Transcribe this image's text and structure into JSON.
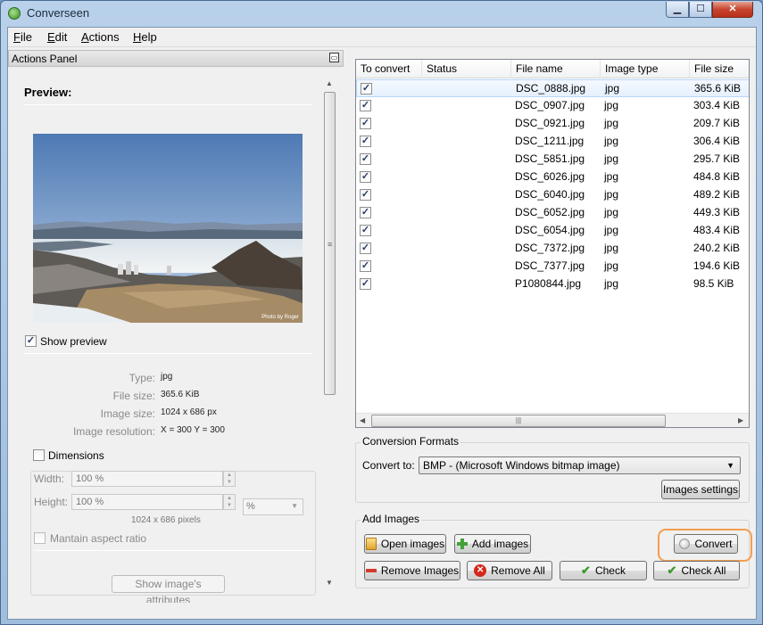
{
  "window": {
    "title": "Converseen"
  },
  "menu": [
    "File",
    "Edit",
    "Actions",
    "Help"
  ],
  "actions_panel": {
    "title": "Actions Panel",
    "preview_title": "Preview:",
    "photo_credit": "Photo by Roger",
    "show_preview": {
      "label": "Show preview",
      "checked": true
    },
    "info": {
      "type_label": "Type:",
      "type_value": "jpg",
      "size_label": "File size:",
      "size_value": "365.6 KiB",
      "dims_label": "Image size:",
      "dims_value": "1024 x 686 px",
      "res_label": "Image resolution:",
      "res_value": "X = 300 Y = 300"
    },
    "dimensions": {
      "label": "Dimensions",
      "checked": false,
      "width_label": "Width:",
      "width_value": "100 %",
      "height_label": "Height:",
      "height_value": "100 %",
      "unit": "%",
      "pixels": "1024 x 686 pixels",
      "aspect_label": "Mantain aspect ratio",
      "attributes_button": "Show image's attributes"
    }
  },
  "table": {
    "columns": [
      "To convert",
      "Status",
      "File name",
      "Image type",
      "File size"
    ],
    "rows": [
      {
        "checked": true,
        "status": "",
        "name": "DSC_0888.jpg",
        "type": "jpg",
        "size": "365.6 KiB"
      },
      {
        "checked": true,
        "status": "",
        "name": "DSC_0907.jpg",
        "type": "jpg",
        "size": "303.4 KiB"
      },
      {
        "checked": true,
        "status": "",
        "name": "DSC_0921.jpg",
        "type": "jpg",
        "size": "209.7 KiB"
      },
      {
        "checked": true,
        "status": "",
        "name": "DSC_1211.jpg",
        "type": "jpg",
        "size": "306.4 KiB"
      },
      {
        "checked": true,
        "status": "",
        "name": "DSC_5851.jpg",
        "type": "jpg",
        "size": "295.7 KiB"
      },
      {
        "checked": true,
        "status": "",
        "name": "DSC_6026.jpg",
        "type": "jpg",
        "size": "484.8 KiB"
      },
      {
        "checked": true,
        "status": "",
        "name": "DSC_6040.jpg",
        "type": "jpg",
        "size": "489.2 KiB"
      },
      {
        "checked": true,
        "status": "",
        "name": "DSC_6052.jpg",
        "type": "jpg",
        "size": "449.3 KiB"
      },
      {
        "checked": true,
        "status": "",
        "name": "DSC_6054.jpg",
        "type": "jpg",
        "size": "483.4 KiB"
      },
      {
        "checked": true,
        "status": "",
        "name": "DSC_7372.jpg",
        "type": "jpg",
        "size": "240.2 KiB"
      },
      {
        "checked": true,
        "status": "",
        "name": "DSC_7377.jpg",
        "type": "jpg",
        "size": "194.6 KiB"
      },
      {
        "checked": true,
        "status": "",
        "name": "P1080844.jpg",
        "type": "jpg",
        "size": "98.5 KiB"
      }
    ]
  },
  "conversion": {
    "title": "Conversion Formats",
    "convert_to_label": "Convert to:",
    "format": "BMP - (Microsoft Windows bitmap image)",
    "settings_button": "Images settings"
  },
  "add_images": {
    "title": "Add Images",
    "open": "Open images",
    "add": "Add images",
    "convert": "Convert",
    "remove": "Remove Images",
    "remove_all": "Remove All",
    "check": "Check",
    "check_all": "Check All"
  },
  "colors": {
    "highlight": "#f29d51",
    "selection": "#e5f0fd",
    "check_green": "#3b9a2c",
    "remove_red": "#d23a2e"
  }
}
